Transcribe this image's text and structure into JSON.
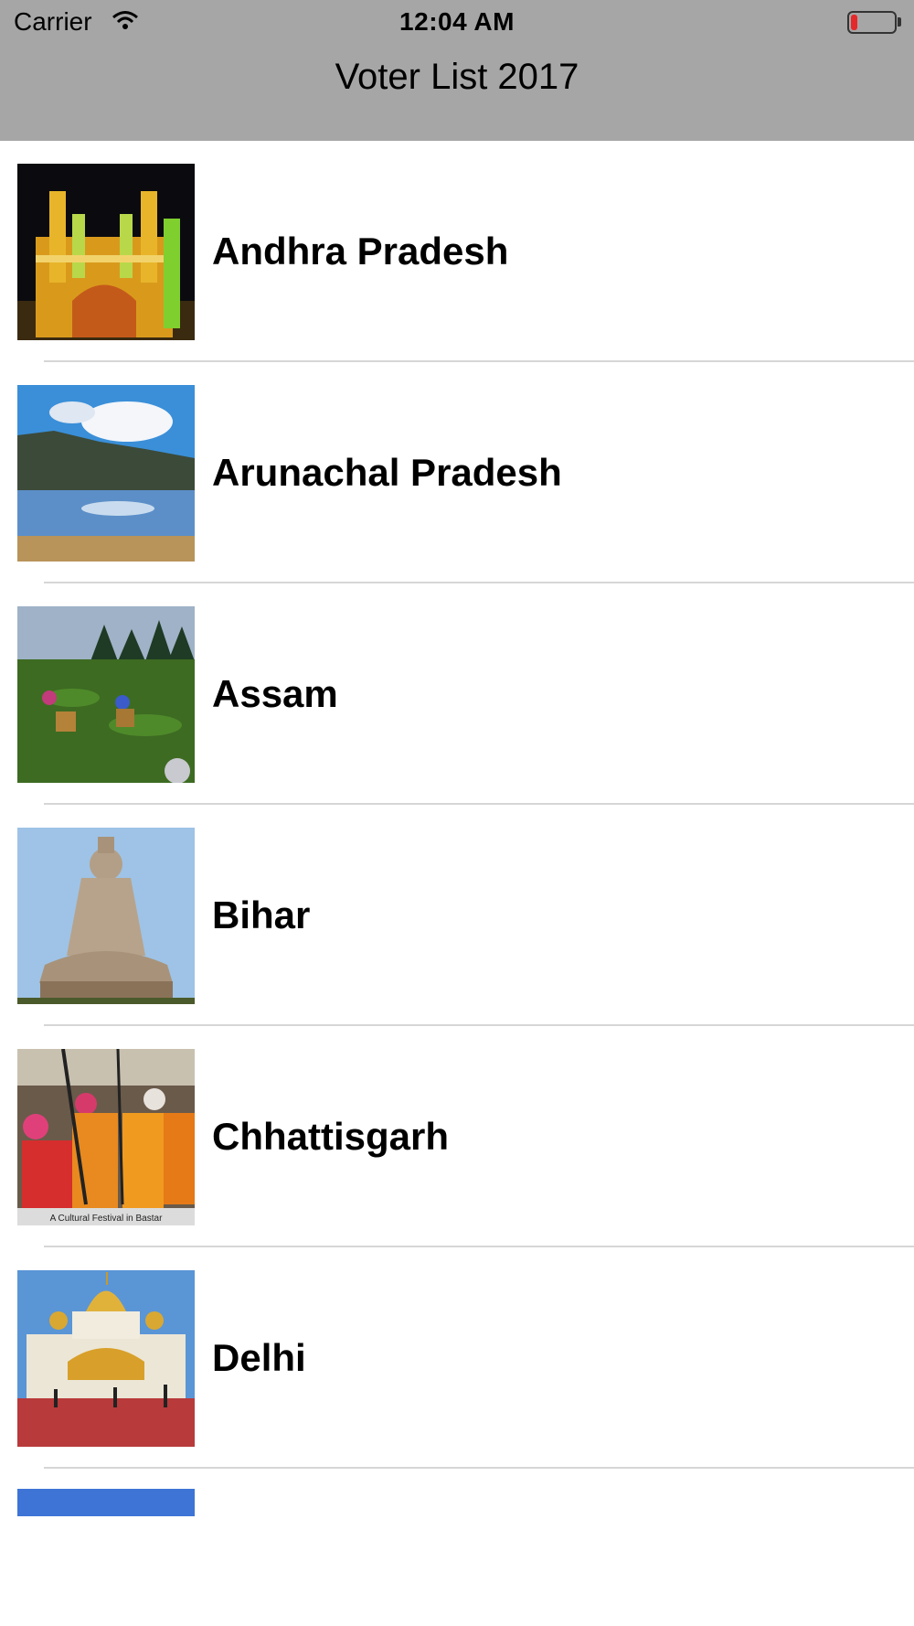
{
  "status_bar": {
    "carrier": "Carrier",
    "time": "12:04 AM",
    "battery_color": "#e5282a",
    "battery_level": 0.15
  },
  "nav": {
    "title": "Voter List 2017",
    "background": "#a6a6a6"
  },
  "states": [
    {
      "name": "Andhra Pradesh"
    },
    {
      "name": "Arunachal Pradesh"
    },
    {
      "name": "Assam"
    },
    {
      "name": "Bihar"
    },
    {
      "name": "Chhattisgarh",
      "image_caption": "A Cultural Festival in Bastar"
    },
    {
      "name": "Delhi"
    }
  ]
}
